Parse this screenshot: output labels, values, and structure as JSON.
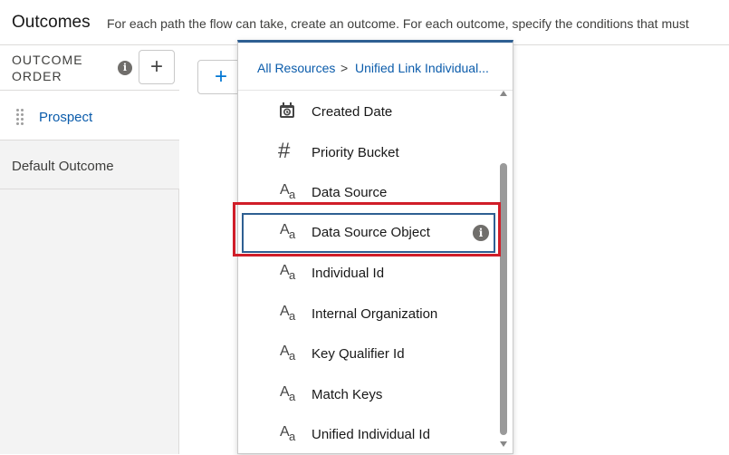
{
  "header": {
    "title": "Outcomes",
    "description": "For each path the flow can take, create an outcome. For each outcome, specify the conditions that must"
  },
  "left_panel": {
    "order_label": "OUTCOME ORDER",
    "outcomes": [
      "Prospect",
      "Default Outcome"
    ]
  },
  "dropdown": {
    "breadcrumb": {
      "root": "All Resources",
      "separator": ">",
      "current": "Unified Link Individual..."
    },
    "items": [
      {
        "label": "Created Date",
        "icon": "calendar-icon"
      },
      {
        "label": "Priority Bucket",
        "icon": "number-icon"
      },
      {
        "label": "Data Source",
        "icon": "text-icon"
      },
      {
        "label": "Data Source Object",
        "icon": "text-icon",
        "highlighted": true
      },
      {
        "label": "Individual Id",
        "icon": "text-icon"
      },
      {
        "label": "Internal Organization",
        "icon": "text-icon"
      },
      {
        "label": "Key Qualifier Id",
        "icon": "text-icon"
      },
      {
        "label": "Match Keys",
        "icon": "text-icon"
      },
      {
        "label": "Unified Individual Id",
        "icon": "text-icon"
      }
    ]
  },
  "colors": {
    "link": "#0b5cab",
    "highlight_border": "#2e5f92",
    "annotation_red": "#d01e29"
  }
}
